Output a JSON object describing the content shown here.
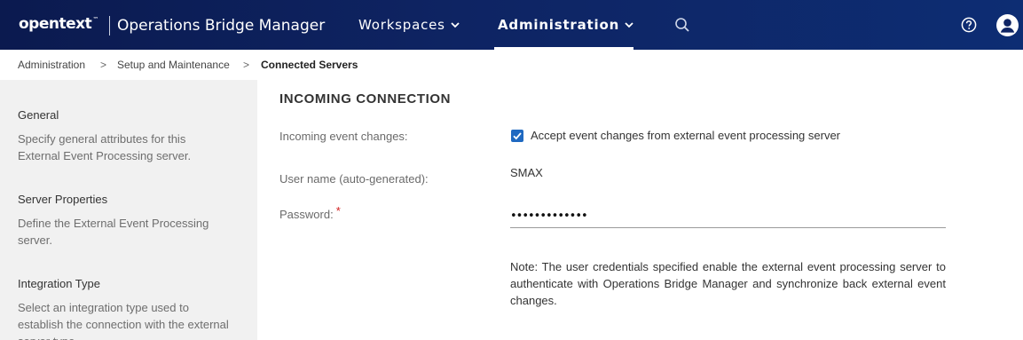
{
  "header": {
    "logo": "opentext",
    "logo_tm": "™",
    "app_title": "Operations Bridge Manager",
    "nav": [
      {
        "label": "Workspaces",
        "active": false
      },
      {
        "label": "Administration",
        "active": true
      }
    ],
    "icons": [
      "search-icon",
      "help-icon",
      "user-avatar-icon"
    ]
  },
  "breadcrumb": {
    "items": [
      "Administration",
      "Setup and Maintenance",
      "Connected Servers"
    ],
    "separator": ">"
  },
  "sidebar": {
    "sections": [
      {
        "title": "General",
        "description": "Specify general attributes for this External Event Processing server."
      },
      {
        "title": "Server Properties",
        "description": "Define the External Event Processing server."
      },
      {
        "title": "Integration Type",
        "description": "Select an integration type used to establish the connection with the external server type."
      }
    ]
  },
  "main": {
    "section_title": "INCOMING CONNECTION",
    "incoming_label": "Incoming event changes:",
    "incoming_checkbox_label": "Accept event changes from external event processing server",
    "incoming_checked": true,
    "username_label": "User name (auto-generated):",
    "username_value": "SMAX",
    "password_label": "Password:",
    "password_required_mark": "*",
    "password_value": "•••••••••••••",
    "note": "Note: The user credentials specified enable the external event processing server to authenticate with Operations Bridge Manager and synchronize back external event changes."
  },
  "colors": {
    "header_bg": "#0e2463",
    "accent": "#1f69c1",
    "required": "#d11f1f",
    "sidebar_bg": "#f1f1f1"
  }
}
